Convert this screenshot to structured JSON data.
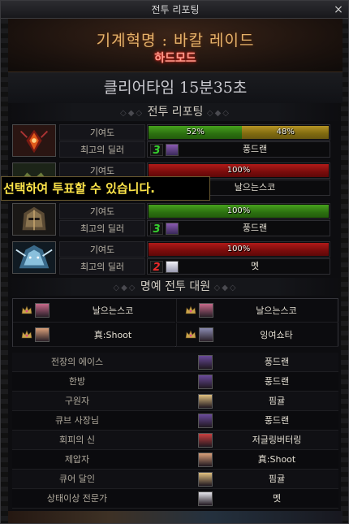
{
  "window": {
    "title": "전투 리포팅",
    "close_glyph": "×"
  },
  "header": {
    "raid_name": "기계혁명 : 바칼 레이드",
    "difficulty": "하드모드"
  },
  "clear_time": "클리어타임 15분35초",
  "sections": {
    "battle_report": "전투 리포팅",
    "honor": "명예 전투 대원"
  },
  "report_rows": [
    {
      "contribution_label": "기여도",
      "dealer_label": "최고의 딜러",
      "bars": [
        {
          "text": "52%",
          "percent": 52,
          "color": "green"
        },
        {
          "text": "48%",
          "percent": 48,
          "color": "gold"
        }
      ],
      "party_number": "3",
      "party_color": "green",
      "dealer": "풍드랜",
      "portrait_icon": "flame-boss-icon"
    },
    {
      "contribution_label": "기여도",
      "dealer_label": "최고의 딜러",
      "bars": [
        {
          "text": "100%",
          "percent": 100,
          "color": "red"
        }
      ],
      "party_number": "",
      "party_color": "red",
      "dealer": "날으는스코",
      "portrait_icon": "winged-boss-icon"
    },
    {
      "contribution_label": "기여도",
      "dealer_label": "최고의 딜러",
      "bars": [
        {
          "text": "100%",
          "percent": 100,
          "color": "green"
        }
      ],
      "party_number": "3",
      "party_color": "green",
      "dealer": "풍드랜",
      "portrait_icon": "helmet-boss-icon"
    },
    {
      "contribution_label": "기여도",
      "dealer_label": "최고의 딜러",
      "bars": [
        {
          "text": "100%",
          "percent": 100,
          "color": "red"
        }
      ],
      "party_number": "2",
      "party_color": "red",
      "dealer": "멧",
      "portrait_icon": "ice-boss-icon"
    }
  ],
  "vote_tooltip": "선택하여 투표할 수 있습니다.",
  "honor_members": [
    {
      "name": "날으는스코",
      "face_color": "#c76a8a"
    },
    {
      "name": "날으는스코",
      "face_color": "#c76a8a"
    },
    {
      "name": "真:Shoot",
      "face_color": "#d9a07a"
    },
    {
      "name": "잉여쇼타",
      "face_color": "#8a8ab0"
    }
  ],
  "awards": [
    {
      "title": "전장의 에이스",
      "name": "풍드랜",
      "face_color": "#6a4a9a"
    },
    {
      "title": "한방",
      "name": "풍드랜",
      "face_color": "#6a4a9a"
    },
    {
      "title": "구원자",
      "name": "핌귤",
      "face_color": "#e0c080"
    },
    {
      "title": "큐브 사장님",
      "name": "풍드랜",
      "face_color": "#6a4a9a"
    },
    {
      "title": "회피의 신",
      "name": "저글링버터링",
      "face_color": "#c84040"
    },
    {
      "title": "제압자",
      "name": "真:Shoot",
      "face_color": "#d9a07a"
    },
    {
      "title": "큐어 달인",
      "name": "핌귤",
      "face_color": "#e0c080"
    },
    {
      "title": "상태이상 전문가",
      "name": "멧",
      "face_color": "#e8e8ee"
    }
  ],
  "colors": {
    "green_bar": "#3a8a18",
    "gold_bar": "#8a7314",
    "red_bar": "#8a1010",
    "accent_gold": "#e6b26a",
    "hard_red": "#ff3020"
  }
}
